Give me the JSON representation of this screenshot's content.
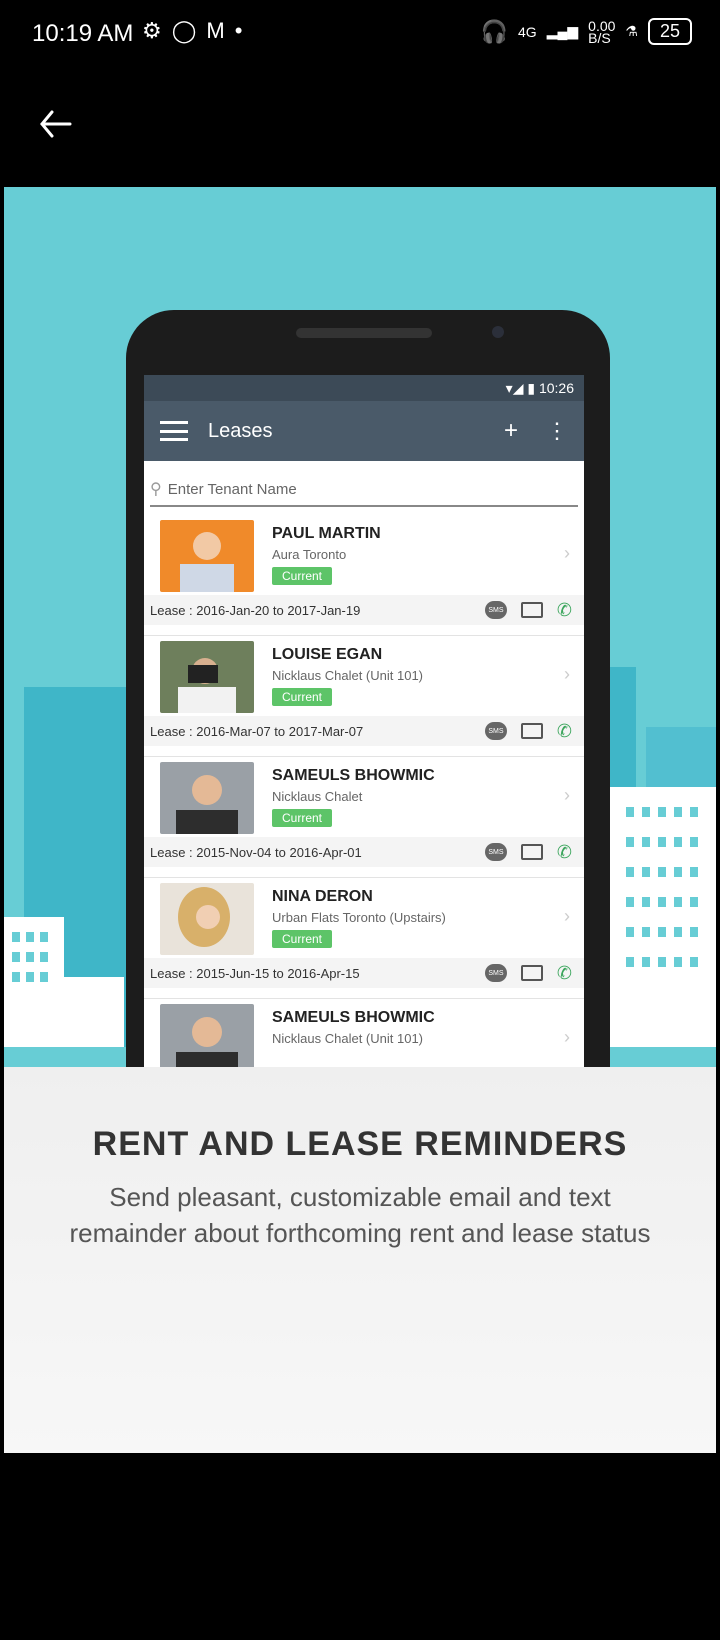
{
  "status_bar": {
    "time": "10:19 AM",
    "network": "4G",
    "speed": "0.00\nB/S",
    "battery": "25"
  },
  "banner": {
    "phone_screen": {
      "time": "10:26",
      "appbar_title": "Leases",
      "search_placeholder": "Enter Tenant Name",
      "tenants": [
        {
          "name": "PAUL MARTIN",
          "place": "Aura Toronto",
          "status": "Current",
          "lease": "Lease : 2016-Jan-20 to 2017-Jan-19"
        },
        {
          "name": "LOUISE EGAN",
          "place": "Nicklaus Chalet (Unit 101)",
          "status": "Current",
          "lease": "Lease : 2016-Mar-07 to 2017-Mar-07"
        },
        {
          "name": "SAMEULS BHOWMIC",
          "place": "Nicklaus Chalet",
          "status": "Current",
          "lease": "Lease : 2015-Nov-04 to 2016-Apr-01"
        },
        {
          "name": "NINA DERON",
          "place": "Urban Flats Toronto (Upstairs)",
          "status": "Current",
          "lease": "Lease : 2015-Jun-15 to 2016-Apr-15"
        },
        {
          "name": "SAMEULS BHOWMIC",
          "place": "Nicklaus Chalet (Unit 101)",
          "status": "",
          "lease": ""
        }
      ],
      "sms_label": "SMS"
    }
  },
  "footer": {
    "title": "RENT AND LEASE REMINDERS",
    "subtitle_line1": "Send pleasant, customizable email and text",
    "subtitle_line2": "remainder about forthcoming rent and lease status"
  }
}
